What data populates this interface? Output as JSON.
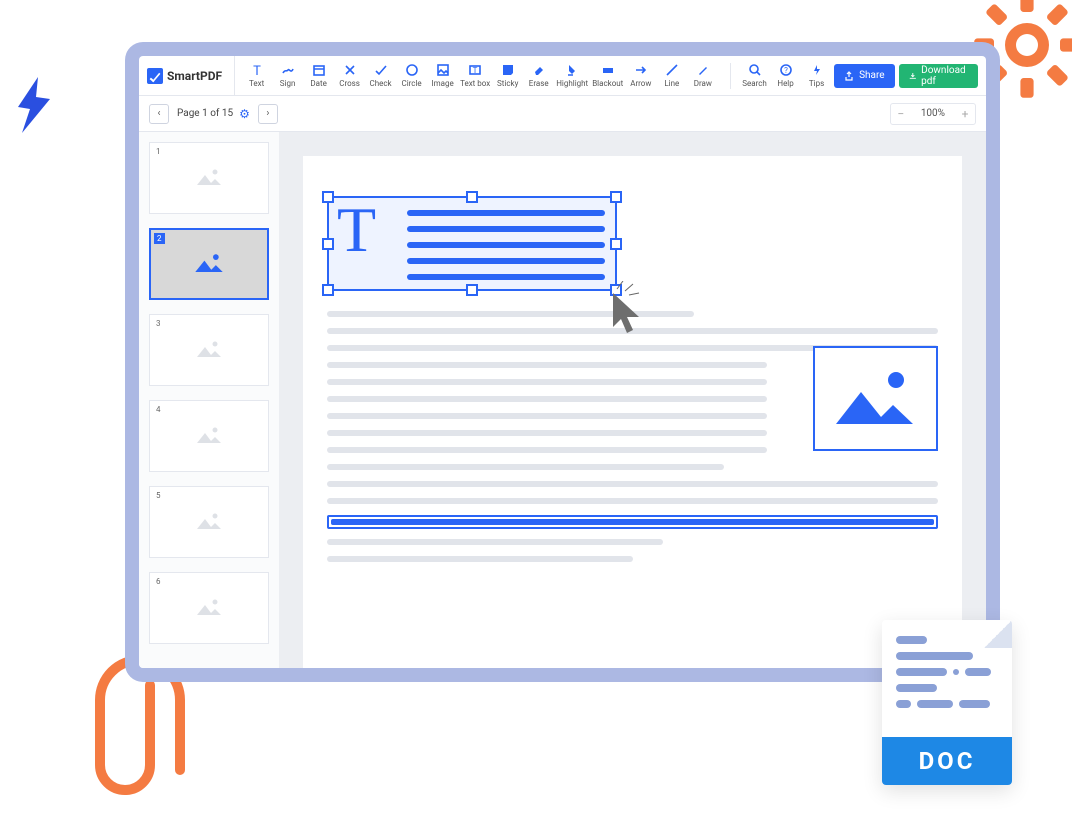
{
  "app": {
    "name": "SmartPDF"
  },
  "toolbar": {
    "tools": [
      {
        "id": "text",
        "label": "Text"
      },
      {
        "id": "sign",
        "label": "Sign"
      },
      {
        "id": "date",
        "label": "Date"
      },
      {
        "id": "cross",
        "label": "Cross"
      },
      {
        "id": "check",
        "label": "Check"
      },
      {
        "id": "circle",
        "label": "Circle"
      },
      {
        "id": "image",
        "label": "Image"
      },
      {
        "id": "textbox",
        "label": "Text box"
      },
      {
        "id": "sticky",
        "label": "Sticky"
      },
      {
        "id": "erase",
        "label": "Erase"
      },
      {
        "id": "highlight",
        "label": "Highlight"
      },
      {
        "id": "blackout",
        "label": "Blackout"
      },
      {
        "id": "arrow",
        "label": "Arrow"
      },
      {
        "id": "line",
        "label": "Line"
      },
      {
        "id": "draw",
        "label": "Draw"
      }
    ],
    "utility": [
      {
        "id": "search",
        "label": "Search"
      },
      {
        "id": "help",
        "label": "Help"
      },
      {
        "id": "tips",
        "label": "Tips"
      }
    ],
    "share_label": "Share",
    "download_label": "Download pdf"
  },
  "pagebar": {
    "indicator": "Page 1 of 15",
    "current_page": 1,
    "total_pages": 15
  },
  "zoom": {
    "value": "100%"
  },
  "thumbnails": [
    {
      "num": "1",
      "active": false
    },
    {
      "num": "2",
      "active": true
    },
    {
      "num": "3",
      "active": false
    },
    {
      "num": "4",
      "active": false
    },
    {
      "num": "5",
      "active": false
    },
    {
      "num": "6",
      "active": false
    }
  ],
  "doc_badge": {
    "label": "DOC"
  }
}
